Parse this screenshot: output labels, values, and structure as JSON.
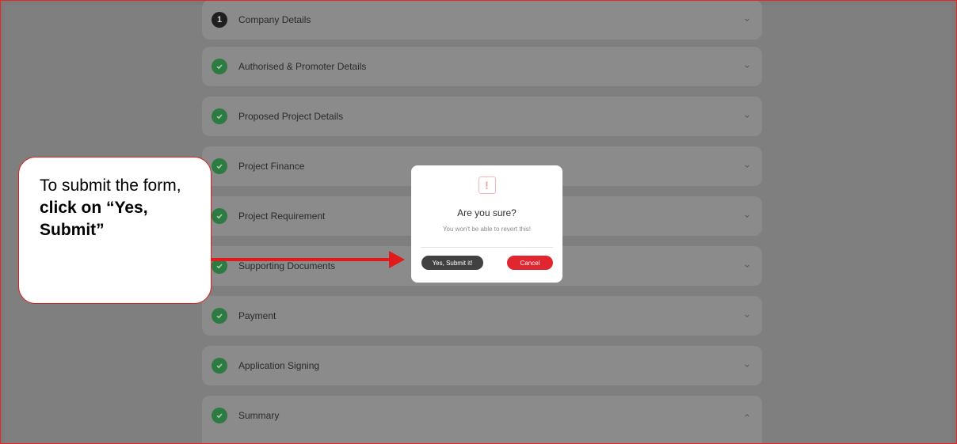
{
  "sections": [
    {
      "label": "Company Details",
      "status": "number",
      "step": "1",
      "chevron": "chevron-down-icon"
    },
    {
      "label": "Authorised & Promoter Details",
      "status": "done",
      "chevron": "chevron-down-icon"
    },
    {
      "label": "Proposed Project Details",
      "status": "done",
      "chevron": "chevron-down-icon"
    },
    {
      "label": "Project Finance",
      "status": "done",
      "chevron": "chevron-down-icon"
    },
    {
      "label": "Project Requirement",
      "status": "done",
      "chevron": "chevron-down-icon"
    },
    {
      "label": "Supporting Documents",
      "status": "done",
      "chevron": "chevron-down-icon"
    },
    {
      "label": "Payment",
      "status": "done",
      "chevron": "chevron-down-icon"
    },
    {
      "label": "Application Signing",
      "status": "done",
      "chevron": "chevron-down-icon"
    },
    {
      "label": "Summary",
      "status": "done",
      "chevron": "chevron-up-icon"
    }
  ],
  "modal": {
    "icon": "exclamation-icon",
    "title": "Are you sure?",
    "message": "You won't be able to revert this!",
    "confirm_label": "Yes, Submit it!",
    "cancel_label": "Cancel"
  },
  "callout": {
    "text_plain": "To submit the form, ",
    "text_bold": "click on “Yes, Submit”"
  },
  "colors": {
    "accent_red": "#e22630",
    "success_green": "#2e7a43",
    "overlay": "#7f7f7f"
  }
}
